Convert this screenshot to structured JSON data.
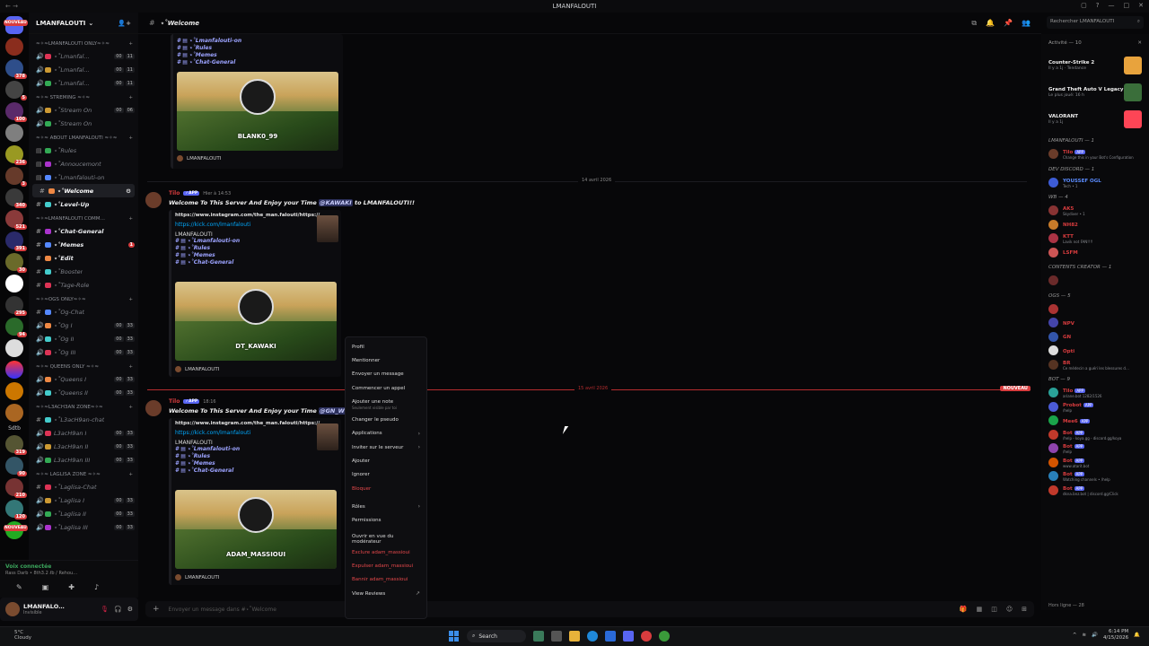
{
  "window": {
    "title": "LMANFALOUTI"
  },
  "guilds": {
    "new_label_top": "NOUVEAU",
    "new_label_bottom": "NOUVEAU",
    "badges": [
      "378",
      "5",
      "100",
      "236",
      "3",
      "340",
      "521",
      "391",
      "30",
      "295",
      "94"
    ],
    "sdtb_label": "Sdtb",
    "more_badges": [
      "319",
      "90",
      "210",
      "120"
    ]
  },
  "server": {
    "name": "LMANFALOUTI",
    "categories": [
      {
        "name": "≈✧≈LMANFALOUTI ONLY≈✧≈",
        "channels": [
          {
            "icon": "🔊",
            "name": "⋆˚Lmanfal…",
            "c1": "00",
            "c2": "11"
          },
          {
            "icon": "🔊",
            "name": "⋆˚Lmanfal…",
            "c1": "00",
            "c2": "11"
          },
          {
            "icon": "🔊",
            "name": "⋆˚Lmanfal…",
            "c1": "00",
            "c2": "11"
          }
        ]
      },
      {
        "name": "≈✧≈ STREMING ≈✧≈",
        "channels": [
          {
            "icon": "🔊",
            "name": "⋆˚Stream On",
            "c1": "00",
            "c2": "06"
          },
          {
            "icon": "🔊",
            "name": "⋆˚Stream On",
            "c1": "",
            "c2": ""
          }
        ]
      },
      {
        "name": "≈✧≈ ABOUT LMANFALOUTI ≈✧≈",
        "channels": [
          {
            "icon": "▤",
            "name": "⋆˚Rules",
            "c1": "",
            "c2": ""
          },
          {
            "icon": "▤",
            "name": "⋆˚Annoucemont",
            "c1": "",
            "c2": ""
          },
          {
            "icon": "▤",
            "name": "⋆˚Lmanfalouti-on",
            "c1": "",
            "c2": ""
          },
          {
            "icon": "#",
            "name": "⋆˚Welcome",
            "c1": "",
            "c2": "",
            "active": true
          },
          {
            "icon": "#",
            "name": "⋆˚Level-Up",
            "c1": "",
            "c2": "",
            "unread": true
          }
        ]
      },
      {
        "name": "≈✧≈LMANFALOUTI COMM…",
        "channels": [
          {
            "icon": "#",
            "name": "⋆˚Chat-General",
            "c1": "",
            "c2": "",
            "unread": true
          },
          {
            "icon": "#",
            "name": "⋆˚Memes",
            "c1": "",
            "c2": "",
            "unread": true,
            "mention": "1"
          },
          {
            "icon": "#",
            "name": "⋆˚Edit",
            "c1": "",
            "c2": "",
            "unread": true
          },
          {
            "icon": "#",
            "name": "⋆˚Booster",
            "c1": "",
            "c2": ""
          },
          {
            "icon": "#",
            "name": "⋆˚Tage-Role",
            "c1": "",
            "c2": ""
          }
        ]
      },
      {
        "name": "≈✧≈OGS ONLY≈✧≈",
        "channels": [
          {
            "icon": "#",
            "name": "⋆˚Og-Chat",
            "c1": "",
            "c2": ""
          },
          {
            "icon": "🔊",
            "name": "⋆˚Og I",
            "c1": "00",
            "c2": "33"
          },
          {
            "icon": "🔊",
            "name": "⋆˚Og II",
            "c1": "00",
            "c2": "33"
          },
          {
            "icon": "🔊",
            "name": "⋆˚Og III",
            "c1": "00",
            "c2": "33"
          }
        ]
      },
      {
        "name": "≈✧≈ QUEENS ONLY ≈✧≈",
        "channels": [
          {
            "icon": "🔊",
            "name": "⋆˚Queens I",
            "c1": "00",
            "c2": "33"
          },
          {
            "icon": "🔊",
            "name": "⋆˚Queens II",
            "c1": "00",
            "c2": "33"
          }
        ]
      },
      {
        "name": "≈✧≈L3ACH3AN ZONE≈✧≈",
        "channels": [
          {
            "icon": "#",
            "name": "⋆˚L3acH9an-chat",
            "c1": "",
            "c2": ""
          },
          {
            "icon": "🔊",
            "name": "L3acH9an I",
            "c1": "00",
            "c2": "33"
          },
          {
            "icon": "🔊",
            "name": "L3acH9an II",
            "c1": "00",
            "c2": "33"
          },
          {
            "icon": "🔊",
            "name": "L3acH9an III",
            "c1": "00",
            "c2": "33"
          }
        ]
      },
      {
        "name": "≈✧≈ LAGLISA ZONE ≈✧≈",
        "channels": [
          {
            "icon": "#",
            "name": "⋆˚Laglisa-Chat",
            "c1": "",
            "c2": ""
          },
          {
            "icon": "🔊",
            "name": "⋆˚Laglisa I",
            "c1": "00",
            "c2": "33"
          },
          {
            "icon": "🔊",
            "name": "⋆˚Laglisa II",
            "c1": "00",
            "c2": "33"
          },
          {
            "icon": "🔊",
            "name": "⋆˚Laglisa III",
            "c1": "00",
            "c2": "33"
          }
        ]
      }
    ]
  },
  "voice": {
    "status": "Voix connectée",
    "sub": "Rass Darb • 8th3.2 ℓb / Rehou…"
  },
  "user": {
    "name": "LMANFALO…",
    "status": "Invisible"
  },
  "chat": {
    "channel_title": "⋆˚Welcome",
    "search_placeholder": "Rechercher LMANFALOUTI",
    "composer_placeholder": "Envoyer un message dans #⋆˚Welcome",
    "top_embed": {
      "lines": [
        "# ▤ ⋆˚Lmanfalouti-on",
        "# ▤ ⋆˚Rules",
        "# ▤ ⋆˚Memes",
        "# ▤ ⋆˚Chat-General"
      ],
      "banner_name": "BLANK0_99",
      "footer": "LMANFALOUTI"
    },
    "date1": "14 avril 2026",
    "msg1": {
      "author": "Tilo",
      "app": "✓APP",
      "time": "Hier à 14:53",
      "text_pre": "Welcome To This Server And Enjoy your Time ",
      "mention": "@KAWAKI",
      "text_post": " to LMANFALOUTI!!",
      "link": "https://www.instagram.com/the_man.falouti/https://",
      "kick": "https://kick.com/lmanfalouti",
      "etitle": "LMANFALOUTI",
      "lines": [
        "# ▤ ⋆˚Lmanfalouti-on",
        "# ▤ ⋆˚Rules",
        "# ▤ ⋆˚Memes",
        "# ▤ ⋆˚Chat-General"
      ],
      "banner_name": "DT_KAWAKI",
      "footer": "LMANFALOUTI"
    },
    "date2": "15 avril 2026",
    "new_tag": "NOUVEAU",
    "msg2": {
      "author": "Tilo",
      "app": "✓APP",
      "time": "18:16",
      "text_pre": "Welcome To This Server And Enjoy your Time ",
      "mention": "@GN_Wid",
      "text_post": "",
      "link": "https://www.instagram.com/the_man.falouti/https://",
      "kick": "https://kick.com/lmanfalouti",
      "etitle": "LMANFALOUTI",
      "lines": [
        "# ▤ ⋆˚Lmanfalouti-on",
        "# ▤ ⋆˚Rules",
        "# ▤ ⋆˚Memes",
        "# ▤ ⋆˚Chat-General"
      ],
      "banner_name": "ADAM_MASSIOUI",
      "footer": "LMANFALOUTI"
    }
  },
  "context_menu": {
    "profile": "Profil",
    "mention": "Mentionner",
    "send_message": "Envoyer un message",
    "call": "Commencer un appel",
    "add_note": "Ajouter une note",
    "add_note_sub": "Seulement visible par toi",
    "change_nick": "Changer le pseudo",
    "apps": "Applications",
    "invite": "Inviter sur le serveur",
    "add": "Ajouter",
    "ignore": "Ignorer",
    "block": "Bloquer",
    "roles": "Rôles",
    "permissions": "Permissions",
    "mod_view": "Ouvrir en vue du modérateur",
    "exclude": "Exclure adam_massioui",
    "kick": "Expulser adam_massioui",
    "ban": "Bannir adam_massioui",
    "reviews": "View Reviews"
  },
  "right_panel": {
    "activity_header": "Activité — 10",
    "activities": [
      {
        "name": "Counter-Strike 2",
        "sub": "Il y a 1j · Tendance",
        "color": "#e8a33d"
      },
      {
        "name": "Grand Theft Auto V Legacy",
        "sub": "Le plus joué: 16 h",
        "color": "#3a6e3a"
      },
      {
        "name": "VALORANT",
        "sub": "Il y a 1j",
        "color": "#fd4556"
      }
    ],
    "sections": [
      {
        "name": "LMANFALOUTI — 1",
        "members": [
          {
            "n": "Tilo",
            "s": "Change this in your Bot's Configuration",
            "badge": "APP",
            "color": "#6a3c2a"
          }
        ]
      },
      {
        "name": "DEV DISCORD — 1",
        "members": [
          {
            "n": "YOUSSEF OGL",
            "s": "Tech • 1",
            "badge": "",
            "color": "#3d5cd6",
            "ncolor": "#5b8cff"
          }
        ]
      },
      {
        "name": "WB — 4",
        "members": [
          {
            "n": "AK5",
            "s": "Skydiver • 1",
            "badge": "",
            "color": "#883333"
          },
          {
            "n": "NH82",
            "s": "",
            "badge": "",
            "color": "#c77b2a"
          },
          {
            "n": "KTT",
            "s": "Lavik not FAN!!!!",
            "badge": "",
            "color": "#a34"
          },
          {
            "n": "LSFM",
            "s": "",
            "badge": "",
            "color": "#c55"
          }
        ]
      },
      {
        "name": "CONTENTS CREATOR — 1",
        "members": [
          {
            "n": "",
            "s": "",
            "badge": "",
            "color": "#6a2a2a"
          }
        ]
      },
      {
        "name": "OGS — 5",
        "members": [
          {
            "n": "",
            "s": "",
            "badge": "",
            "color": "#aa3333"
          },
          {
            "n": "NPV",
            "s": "",
            "badge": "",
            "color": "#4444aa"
          },
          {
            "n": "GN",
            "s": "",
            "badge": "",
            "color": "#3355aa"
          },
          {
            "n": "Opti",
            "s": "",
            "badge": "",
            "color": "#dddddd"
          },
          {
            "n": "BR",
            "s": "Ce médecin a guéri les blessures d…",
            "badge": "",
            "color": "#553322"
          }
        ]
      },
      {
        "name": "BOT — 9",
        "members": [
          {
            "n": "Tilo",
            "s": "ariane.bot 1282/1526",
            "badge": "APP",
            "color": "#2aa198"
          },
          {
            "n": "Probot",
            "s": "/help",
            "badge": "APP",
            "color": "#4b5bd6"
          },
          {
            "n": "Mee6",
            "s": "",
            "badge": "APP",
            "color": "#1aa34a"
          },
          {
            "n": "Bot",
            "s": "/help - koya.gg - discord.gg/koya",
            "badge": "APP",
            "color": "#c0392b"
          },
          {
            "n": "Bot",
            "s": "/help",
            "badge": "APP",
            "color": "#8e44ad"
          },
          {
            "n": "Bot",
            "s": "www.atarit.bot",
            "badge": "APP",
            "color": "#d35400"
          },
          {
            "n": "Bot",
            "s": "Watching channels • /help",
            "badge": "APP",
            "color": "#2980b9"
          },
          {
            "n": "Bot",
            "s": "dkna.bnz.bot | discord.gg/Click",
            "badge": "APP",
            "color": "#c0392b"
          }
        ]
      }
    ],
    "offline": "Hors ligne — 28"
  },
  "taskbar": {
    "weather_temp": "5°C",
    "weather_desc": "Cloudy",
    "search": "Search",
    "time": "6:14 PM",
    "date": "4/15/2026"
  }
}
